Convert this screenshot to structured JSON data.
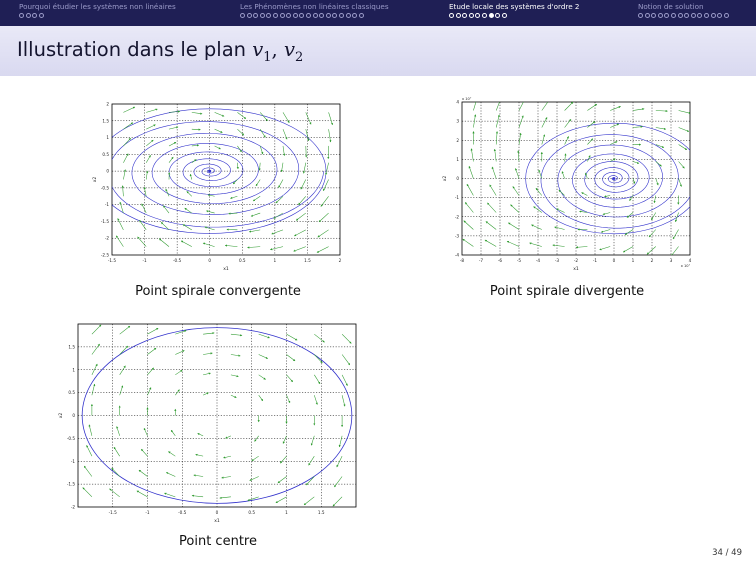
{
  "nav": {
    "sections": [
      {
        "label": "Pourquoi étudier les systèmes non linéaires",
        "dots": 4,
        "current": -1
      },
      {
        "label": "Les Phénomènes non linéaires classiques",
        "dots": 19,
        "current": -1
      },
      {
        "label": "Etude locale des systèmes d'ordre 2",
        "dots": 9,
        "current": 6
      },
      {
        "label": "Notion de solution",
        "dots": 14,
        "current": -1
      }
    ]
  },
  "frame": {
    "title_text": "Illustration dans le plan",
    "title_v": "v",
    "title_sub1": "1",
    "title_sep": ", ",
    "title_sub2": "2",
    "page_number": "34 / 49"
  },
  "colors": {
    "header": "#1f1f55",
    "trajectory": "#3333cc",
    "arrows": "#2e9a2e"
  },
  "chart_data": [
    {
      "type": "vector-field",
      "caption": "Point spirale convergente",
      "xlabel": "x1",
      "ylabel": "x2",
      "xlim": [
        -1.5,
        2
      ],
      "ylim": [
        -2.5,
        2
      ],
      "xticks": [
        -1.5,
        -1,
        -0.5,
        0,
        0.5,
        1,
        1.5,
        2
      ],
      "yticks": [
        -2.5,
        -2,
        -1.5,
        -1,
        -0.5,
        0,
        0.5,
        1,
        1.5,
        2
      ],
      "xtick_labels": [
        "-1.5",
        "-1",
        "-0.5",
        "0",
        "0.5",
        "1",
        "1.5",
        "2"
      ],
      "ytick_labels": [
        "-2.5",
        "-2",
        "-1.5",
        "-1",
        "-0.5",
        "0",
        "0.5",
        "1",
        "1.5",
        "2"
      ],
      "grid": true,
      "dynamics": "spiral-in",
      "equilibrium": [
        0,
        0
      ]
    },
    {
      "type": "vector-field",
      "caption": "Point spirale divergente",
      "xlabel": "x1",
      "ylabel": "x2",
      "x_multiplier": "x 10⁷",
      "y_multiplier": "x 10⁷",
      "xlim": [
        -8,
        4
      ],
      "ylim": [
        -4,
        4
      ],
      "xticks": [
        -8,
        -7,
        -6,
        -5,
        -4,
        -3,
        -2,
        -1,
        0,
        1,
        2,
        3,
        4
      ],
      "yticks": [
        -4,
        -3,
        -2,
        -1,
        0,
        1,
        2,
        3,
        4
      ],
      "xtick_labels": [
        "-8",
        "-7",
        "-6",
        "-5",
        "-4",
        "-3",
        "-2",
        "-1",
        "0",
        "1",
        "2",
        "3",
        "4"
      ],
      "ytick_labels": [
        "-4",
        "-3",
        "-2",
        "-1",
        "0",
        "1",
        "2",
        "3",
        "4"
      ],
      "grid": true,
      "dynamics": "spiral-out",
      "equilibrium": [
        0,
        0
      ]
    },
    {
      "type": "vector-field",
      "caption": "Point centre",
      "xlabel": "x1",
      "ylabel": "x2",
      "xlim": [
        -2,
        2
      ],
      "ylim": [
        -2,
        2
      ],
      "xticks": [
        -1.5,
        -1,
        -0.5,
        0,
        0.5,
        1,
        1.5
      ],
      "yticks": [
        -2,
        -1.5,
        -1,
        -0.5,
        0,
        0.5,
        1,
        1.5
      ],
      "xtick_labels": [
        "-1.5",
        "-1",
        "-0.5",
        "0",
        "0.5",
        "1",
        "1.5"
      ],
      "ytick_labels": [
        "-2",
        "-1.5",
        "-1",
        "-0.5",
        "0",
        "0.5",
        "1",
        "1.5"
      ],
      "grid": true,
      "dynamics": "center",
      "equilibrium": [
        0,
        0
      ]
    }
  ]
}
